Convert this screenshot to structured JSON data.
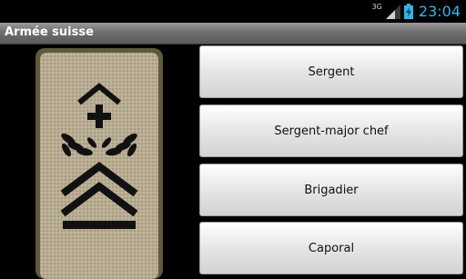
{
  "status_bar": {
    "network_type": "3G",
    "time": "23:04",
    "clock_color": "#33b5e5",
    "icons": [
      "signal-icon",
      "battery-charging-icon"
    ]
  },
  "app": {
    "title": "Armée suisse"
  },
  "insignia": {
    "description_icon": "rank-insignia-image",
    "background_color": "#b4a990"
  },
  "answers": [
    {
      "label": "Sergent"
    },
    {
      "label": "Sergent-major chef"
    },
    {
      "label": "Brigadier"
    },
    {
      "label": "Caporal"
    }
  ]
}
